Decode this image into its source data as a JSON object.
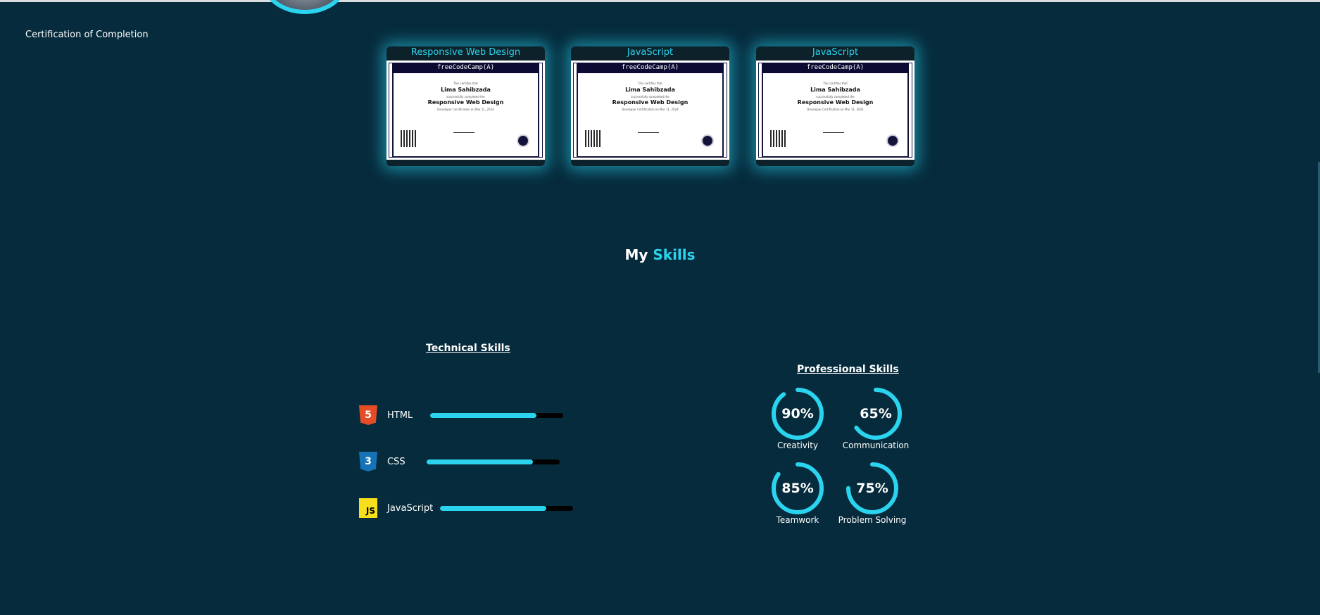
{
  "certification": {
    "heading": "Certification of Completion",
    "cards": [
      {
        "title": "Responsive Web Design",
        "brand": "freeCodeCamp(A)",
        "certifies": "This certifies that",
        "name": "Lima Sahibzada",
        "completed": "successfully completed the",
        "course": "Responsive Web Design",
        "date": "Developer Certification on Mar 11, 2024"
      },
      {
        "title": "JavaScript",
        "brand": "freeCodeCamp(A)",
        "certifies": "This certifies that",
        "name": "Lima Sahibzada",
        "completed": "successfully completed the",
        "course": "Responsive Web Design",
        "date": "Developer Certification on Mar 11, 2024"
      },
      {
        "title": "JavaScript",
        "brand": "freeCodeCamp(A)",
        "certifies": "This certifies that",
        "name": "Lima Sahibzada",
        "completed": "successfully completed the",
        "course": "Responsive Web Design",
        "date": "Developer Certification on Mar 11, 2024"
      }
    ]
  },
  "skills": {
    "title_plain": "My ",
    "title_accent": "Skills",
    "technical": {
      "heading": "Technical Skills",
      "items": [
        {
          "name": "HTML",
          "icon": "html5-icon",
          "glyph": "5",
          "level": 0.8
        },
        {
          "name": "CSS",
          "icon": "css3-icon",
          "glyph": "3",
          "level": 0.8
        },
        {
          "name": "JavaScript",
          "icon": "js-icon",
          "glyph": "JS",
          "level": 0.8
        }
      ]
    },
    "professional": {
      "heading": "Professional Skills",
      "items": [
        {
          "label": "Creativity",
          "percent_text": "90%",
          "value": 90
        },
        {
          "label": "Communication",
          "percent_text": "65%",
          "value": 65
        },
        {
          "label": "Teamwork",
          "percent_text": "85%",
          "value": 85
        },
        {
          "label": "Problem Solving",
          "percent_text": "75%",
          "value": 75
        }
      ]
    }
  },
  "colors": {
    "background": "#062b3c",
    "accent": "#2ad4ee",
    "track": "#000000"
  }
}
